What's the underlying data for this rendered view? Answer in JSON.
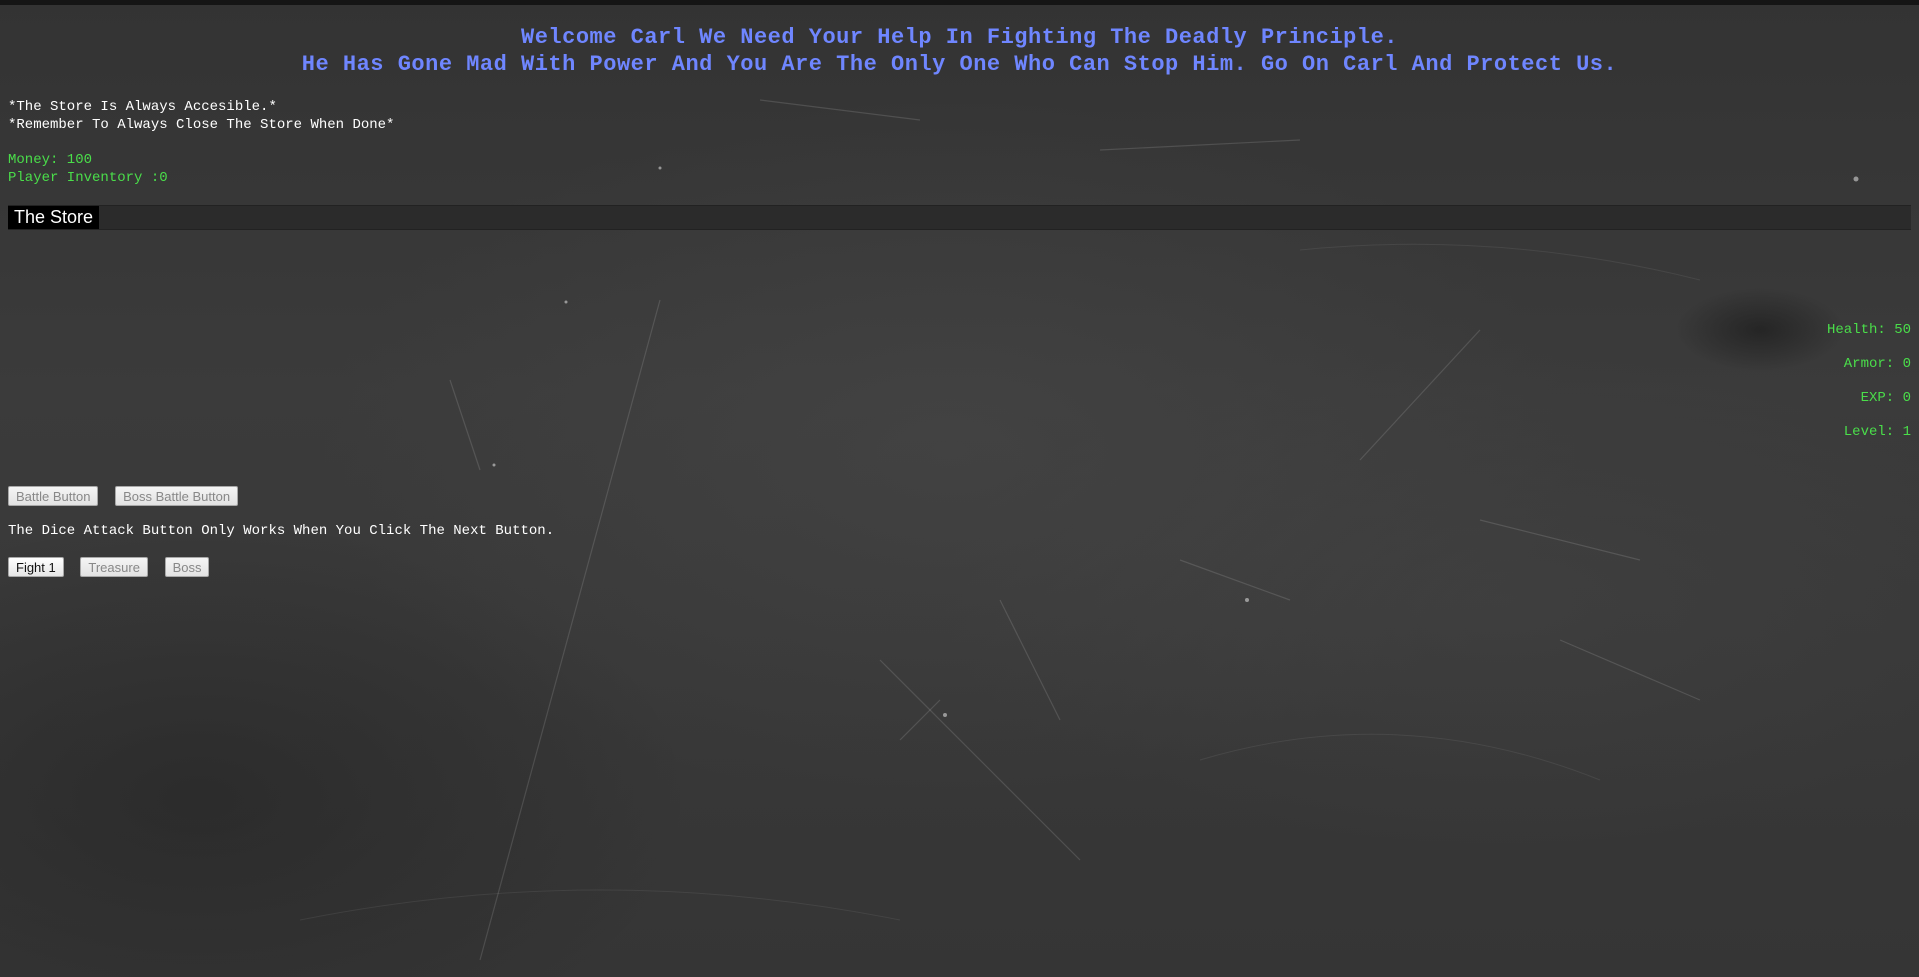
{
  "header": {
    "line1": "Welcome Carl We Need Your Help In Fighting The Deadly Principle.",
    "line2": "He Has Gone Mad With Power And You Are The Only One Who Can Stop Him. Go On Carl And Protect Us."
  },
  "notes": {
    "store_accessible": "*The Store Is Always Accesible.*",
    "close_store": "*Remember To Always Close The Store When Done*"
  },
  "resources": {
    "money": "Money: 100",
    "inventory": "Player Inventory :0"
  },
  "store": {
    "title": "The Store"
  },
  "player_stats": {
    "health": "Health: 50",
    "armor": "Armor: 0",
    "exp": "EXP: 0",
    "level": "Level: 1"
  },
  "battle_buttons": {
    "battle": "Battle Button",
    "boss_battle": "Boss Battle Button"
  },
  "dice_note": "The Dice Attack Button Only Works When You Click The Next Button.",
  "stage_buttons": {
    "fight1": "Fight 1",
    "treasure": "Treasure",
    "boss": "Boss"
  },
  "colors": {
    "header_text": "#6f86ff",
    "stat_text": "#4ade4a",
    "background": "#3a3a3a"
  }
}
